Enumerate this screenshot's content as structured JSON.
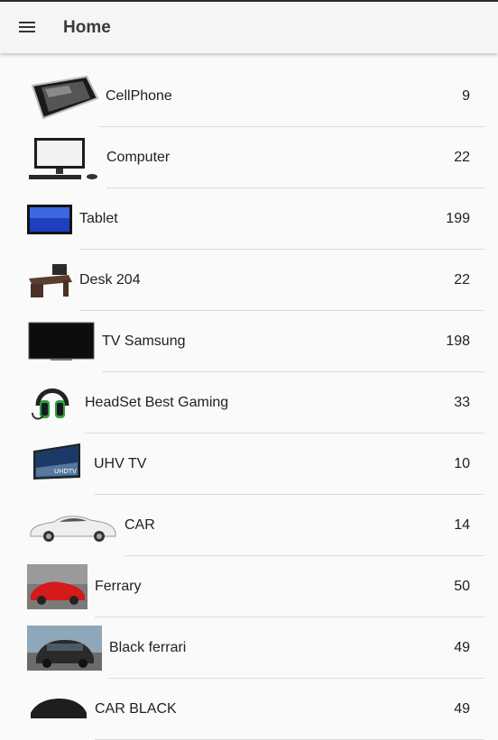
{
  "toolbar": {
    "title": "Home",
    "menu_icon": "menu-icon"
  },
  "items": [
    {
      "label": "CellPhone",
      "count": "9",
      "icon": "cellphone-image"
    },
    {
      "label": "Computer",
      "count": "22",
      "icon": "computer-image"
    },
    {
      "label": "Tablet",
      "count": "199",
      "icon": "tablet-image"
    },
    {
      "label": "Desk 204",
      "count": "22",
      "icon": "desk-image"
    },
    {
      "label": "TV Samsung",
      "count": "198",
      "icon": "tv-image"
    },
    {
      "label": "HeadSet Best Gaming",
      "count": "33",
      "icon": "headset-image"
    },
    {
      "label": "UHV TV",
      "count": "10",
      "icon": "uhd-tv-image"
    },
    {
      "label": "CAR",
      "count": "14",
      "icon": "white-car-image"
    },
    {
      "label": "Ferrary",
      "count": "50",
      "icon": "red-ferrari-image"
    },
    {
      "label": "Black ferrari",
      "count": "49",
      "icon": "black-car-image"
    },
    {
      "label": "CAR BLACK",
      "count": "49",
      "icon": "black-car-image"
    }
  ]
}
